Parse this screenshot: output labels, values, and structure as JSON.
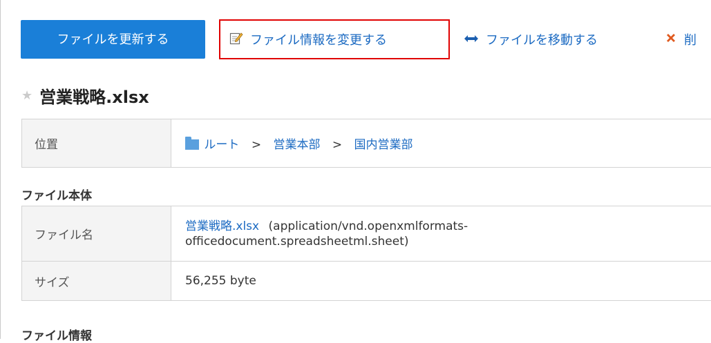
{
  "toolbar": {
    "update_label": "ファイルを更新する",
    "edit_info_label": "ファイル情報を変更する",
    "move_label": "ファイルを移動する",
    "delete_label": "削"
  },
  "file": {
    "title": "営業戦略.xlsx"
  },
  "location": {
    "header": "位置",
    "breadcrumb": [
      "ルート",
      "営業本部",
      "国内営業部"
    ],
    "separator": ">"
  },
  "sections": {
    "file_body": "ファイル本体",
    "file_info": "ファイル情報"
  },
  "file_body": {
    "name_header": "ファイル名",
    "name_link": "営業戦略.xlsx",
    "mime_line1": "(application/vnd.openxmlformats-",
    "mime_line2": "officedocument.spreadsheetml.sheet)",
    "size_header": "サイズ",
    "size_value": "56,255 byte"
  },
  "icons": {
    "edit": "edit-note-icon",
    "move": "move-arrows-icon",
    "delete": "delete-x-icon",
    "star": "star-icon",
    "folder": "folder-icon"
  },
  "colors": {
    "primary": "#1a7fd8",
    "link": "#1b6ac2",
    "highlight_border": "#e00000",
    "delete_icon": "#e05a1f"
  }
}
